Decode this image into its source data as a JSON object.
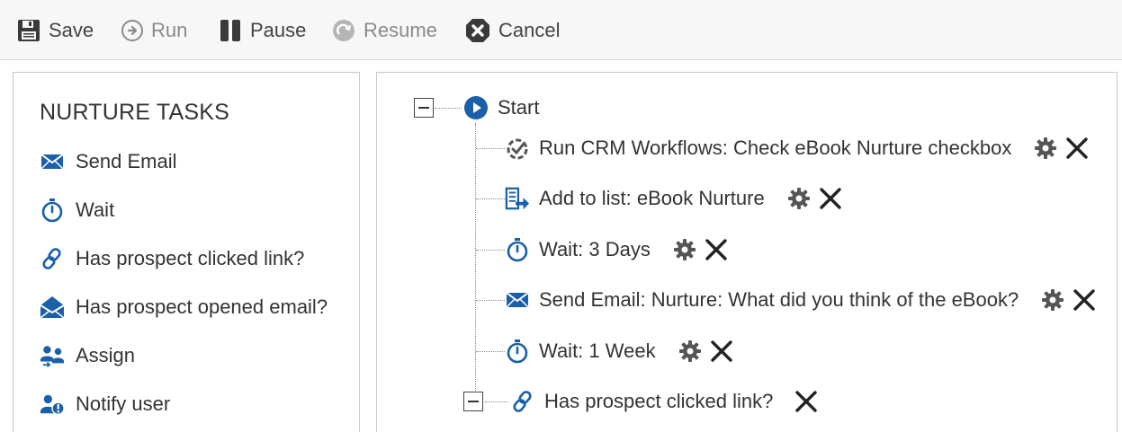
{
  "toolbar": {
    "save": "Save",
    "run": "Run",
    "pause": "Pause",
    "resume": "Resume",
    "cancel": "Cancel"
  },
  "sidebar": {
    "title": "NURTURE TASKS",
    "items": [
      {
        "label": "Send Email",
        "icon": "envelope-icon"
      },
      {
        "label": "Wait",
        "icon": "stopwatch-icon"
      },
      {
        "label": "Has prospect clicked link?",
        "icon": "link-icon"
      },
      {
        "label": "Has prospect opened email?",
        "icon": "open-envelope-icon"
      },
      {
        "label": "Assign",
        "icon": "users-assign-icon"
      },
      {
        "label": "Notify user",
        "icon": "notify-user-icon"
      }
    ]
  },
  "workflow": {
    "start_label": "Start",
    "steps": [
      {
        "label": "Run CRM Workflows: Check eBook Nurture checkbox",
        "icon": "crm-workflow-icon"
      },
      {
        "label": "Add to list: eBook Nurture",
        "icon": "add-to-list-icon"
      },
      {
        "label": "Wait: 3 Days",
        "icon": "stopwatch-icon"
      },
      {
        "label": "Send Email: Nurture: What did you think of the eBook?",
        "icon": "envelope-icon"
      },
      {
        "label": "Wait: 1 Week",
        "icon": "stopwatch-icon"
      }
    ],
    "rule_label": "Has prospect clicked link?"
  },
  "colors": {
    "accent": "#1b5fa8",
    "toolbar_bg": "#f7f7f7",
    "text": "#333333",
    "icon_dark": "#3a3a3a"
  }
}
